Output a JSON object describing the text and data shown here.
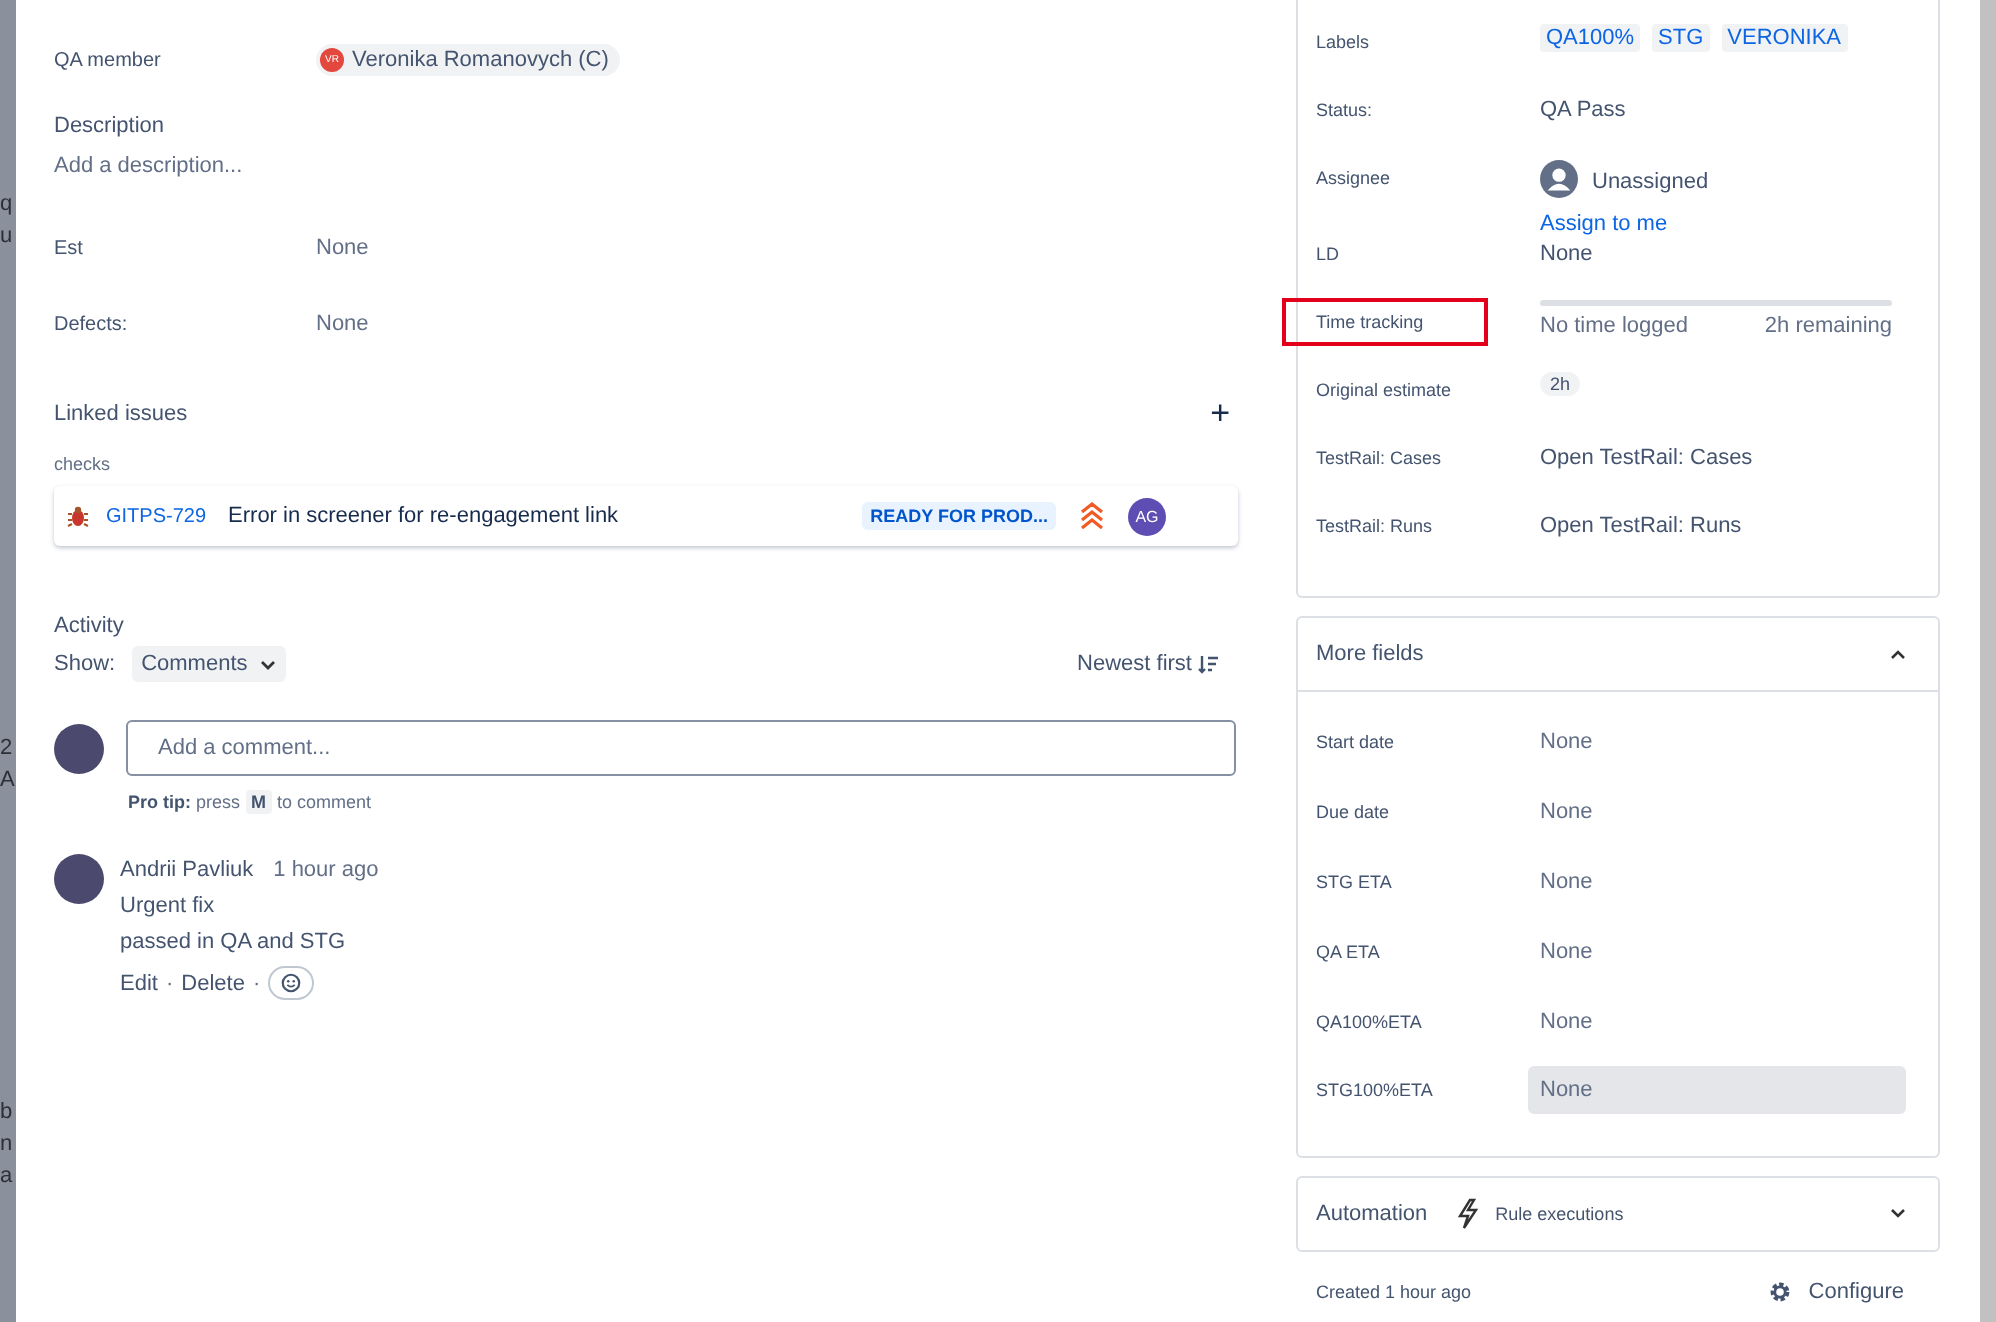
{
  "background_fragments": [
    "q",
    "u",
    "2",
    "A",
    "b",
    "n",
    "a"
  ],
  "left": {
    "fields_top": [
      {
        "label": "QA member",
        "kind": "user",
        "value": "Veronika Romanovych (C)",
        "initials": "VR"
      }
    ],
    "description": {
      "title": "Description",
      "placeholder": "Add a description..."
    },
    "fields": [
      {
        "label": "Est",
        "value": "None"
      },
      {
        "label": "Defects:",
        "value": "None"
      }
    ],
    "linked": {
      "title": "Linked issues",
      "add": "+",
      "relation": "checks",
      "issues": [
        {
          "key": "GITPS-729",
          "summary": "Error in screener for re-engagement link",
          "status": "READY FOR PROD...",
          "assignee": "AG"
        }
      ]
    },
    "activity": {
      "title": "Activity",
      "show_label": "Show:",
      "filter": "Comments",
      "sort": "Newest first",
      "comment_placeholder": "Add a comment...",
      "tip_bold": "Pro tip:",
      "tip_pre": "press",
      "tip_key": "M",
      "tip_post": "to comment",
      "comments": [
        {
          "author": "Andrii Pavliuk",
          "time": "1 hour ago",
          "lines": [
            "Urgent fix",
            "passed in QA and STG"
          ],
          "actions": [
            "Edit",
            "Delete"
          ],
          "separator": "·"
        }
      ]
    }
  },
  "details": [
    {
      "label": "Labels",
      "kind": "labels",
      "values": [
        "QA100%",
        "STG",
        "VERONIKA"
      ],
      "highlighted": false
    },
    {
      "label": "Status:",
      "kind": "text",
      "value": "QA Pass",
      "highlighted": false
    },
    {
      "label": "Assignee",
      "kind": "assignee",
      "value": "Unassigned",
      "action": "Assign to me",
      "highlighted": false
    },
    {
      "label": "LD",
      "kind": "muted",
      "value": "None",
      "highlighted": false
    },
    {
      "label": "Time tracking",
      "kind": "time",
      "logged": "No time logged",
      "remaining": "2h remaining",
      "level": 0,
      "highlighted": true
    },
    {
      "label": "Original estimate",
      "kind": "chip",
      "value": "2h",
      "highlighted": false
    },
    {
      "label": "TestRail: Cases",
      "kind": "text",
      "value": "Open TestRail: Cases",
      "highlighted": false
    },
    {
      "label": "TestRail: Runs",
      "kind": "text",
      "value": "Open TestRail: Runs",
      "highlighted": false
    }
  ],
  "more_fields": {
    "title": "More fields",
    "expanded": true,
    "fields": [
      {
        "label": "Start date",
        "value": "None",
        "hovered": false
      },
      {
        "label": "Due date",
        "value": "None",
        "hovered": false
      },
      {
        "label": "STG ETA",
        "value": "None",
        "hovered": false
      },
      {
        "label": "QA ETA",
        "value": "None",
        "hovered": false
      },
      {
        "label": "QA100%ETA",
        "value": "None",
        "hovered": false
      },
      {
        "label": "STG100%ETA",
        "value": "None",
        "hovered": true
      }
    ]
  },
  "automation": {
    "title": "Automation",
    "subtitle": "Rule executions",
    "expanded": false
  },
  "footer": {
    "created": "Created 1 hour ago",
    "configure": "Configure"
  }
}
